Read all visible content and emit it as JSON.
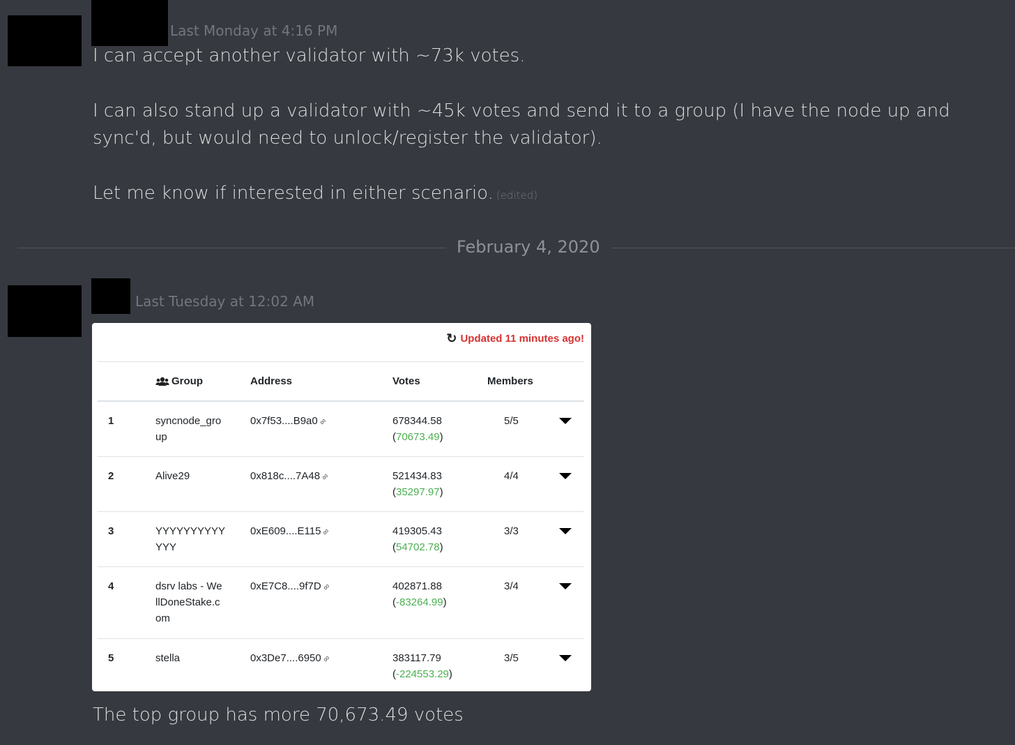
{
  "messages": [
    {
      "timestamp": "Last Monday at 4:16 PM",
      "paragraphs": [
        "I can accept another validator with ~73k votes.",
        "I can also stand up a validator with ~45k votes and send it to a group (I have the node up and sync'd, but would need to unlock/register the validator).",
        "Let me know if interested in either scenario."
      ],
      "edited_label": "(edited)"
    },
    {
      "timestamp": "Last Tuesday at 12:02 AM",
      "caption": "The top group has more 70,673.49 votes"
    }
  ],
  "divider": {
    "label": "February 4, 2020"
  },
  "card": {
    "updated": "Updated 11 minutes ago!",
    "headers": {
      "group": "Group",
      "address": "Address",
      "votes": "Votes",
      "members": "Members"
    },
    "rows": [
      {
        "rank": "1",
        "group": "syncnode_gro up",
        "address": "0x7f53....B9a0",
        "votes": "678344.58",
        "delta": "70673.49",
        "members": "5/5"
      },
      {
        "rank": "2",
        "group": "Alive29",
        "address": "0x818c....7A48",
        "votes": "521434.83",
        "delta": "35297.97",
        "members": "4/4"
      },
      {
        "rank": "3",
        "group": "YYYYYYYYYY YYY",
        "address": "0xE609....E115",
        "votes": "419305.43",
        "delta": "54702.78",
        "members": "3/3"
      },
      {
        "rank": "4",
        "group": "dsrv labs - We llDoneStake.c om",
        "address": "0xE7C8....9f7D",
        "votes": "402871.88",
        "delta": "-83264.99",
        "members": "3/4"
      },
      {
        "rank": "5",
        "group": "stella",
        "address": "0x3De7....6950",
        "votes": "383117.79",
        "delta": "-224553.29",
        "members": "3/5"
      }
    ]
  },
  "colors": {
    "background": "#36393f",
    "updated": "#d63131",
    "delta": "#4caf50"
  }
}
